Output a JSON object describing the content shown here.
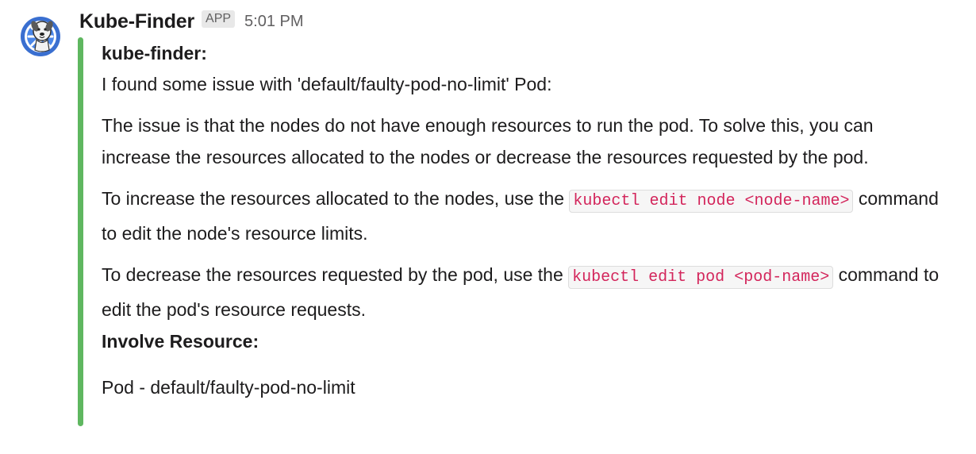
{
  "message": {
    "sender": "Kube-Finder",
    "badge": "APP",
    "time": "5:01 PM",
    "avatar_icon": "kube-finder-dog-helm-icon",
    "accent_color": "#5fb760",
    "title": "kube-finder:",
    "intro": "I found some issue with 'default/faulty-pod-no-limit' Pod:",
    "paragraph1": "The issue is that the nodes do not have enough resources to run the pod. To solve this, you can increase the resources allocated to the nodes or decrease the resources requested by the pod.",
    "paragraph2": {
      "before": "To increase the resources allocated to the nodes, use the ",
      "code": "kubectl edit node <node-name>",
      "after": " command to edit the node's resource limits."
    },
    "paragraph3": {
      "before": "To decrease the resources requested by the pod, use the ",
      "code": "kubectl edit pod <pod-name>",
      "after": " command to edit the pod's resource requests."
    },
    "involve_label": "Involve Resource:",
    "involve_value": "Pod - default/faulty-pod-no-limit"
  }
}
